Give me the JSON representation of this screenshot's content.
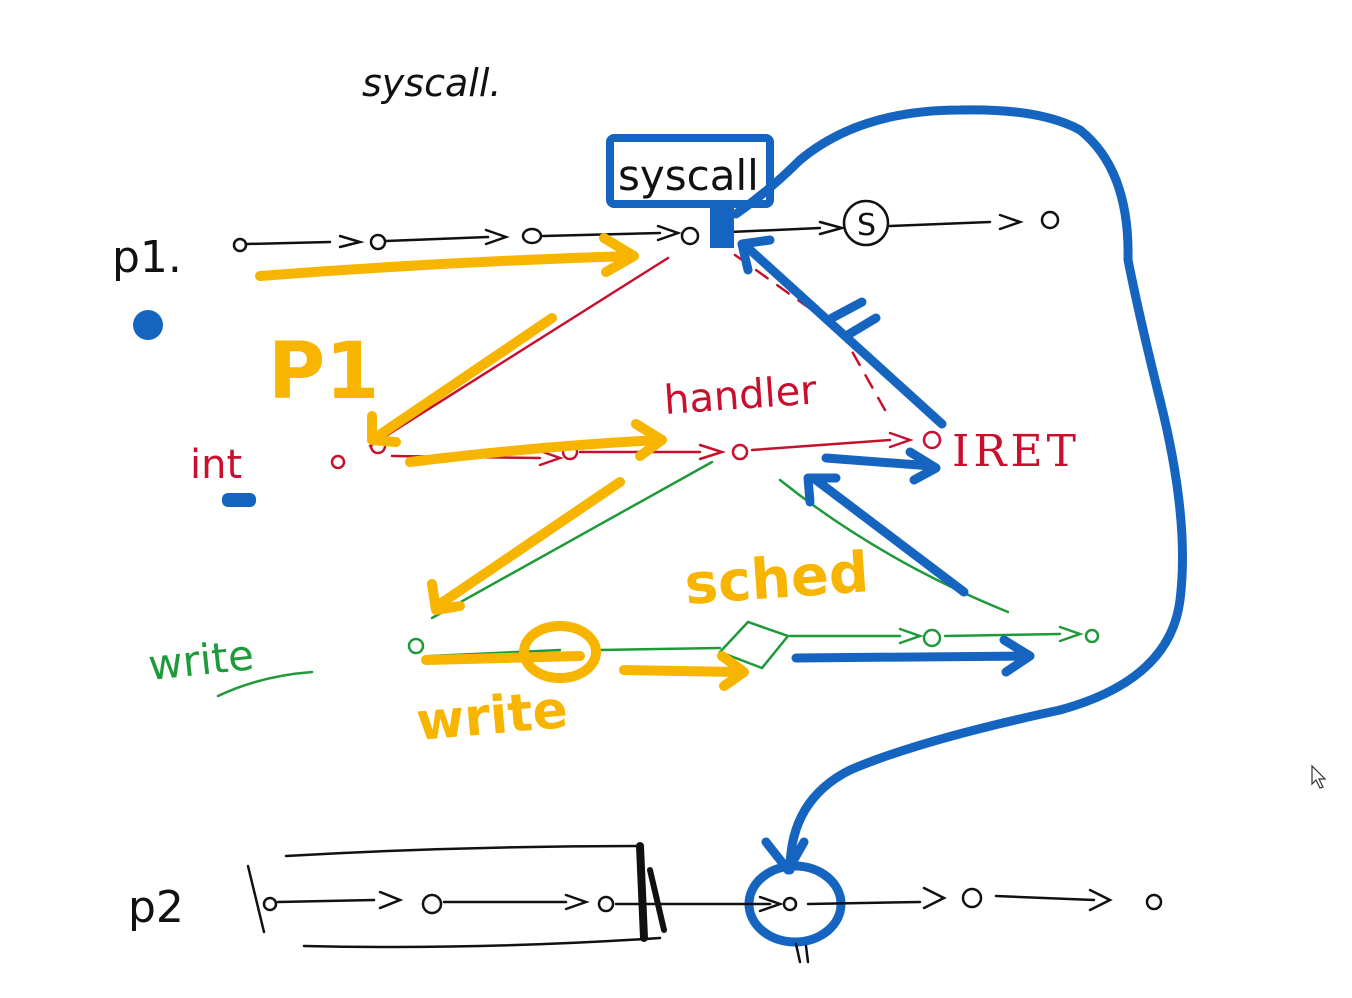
{
  "labels": {
    "top_note": "syscall.",
    "syscall_box": "syscall",
    "p1_label": "p1.",
    "p1_yellow": "P1",
    "int_label": "int",
    "handler_label": "handler",
    "iret_label": "IRET",
    "write_label": "write",
    "write_yellow": "write",
    "sched_yellow": "sched",
    "s_marker": "S",
    "p2_label": "p2"
  },
  "colors": {
    "ink_black": "#111111",
    "ink_red": "#c8102e",
    "ink_green": "#1f9a3a",
    "ink_yellow": "#f7b500",
    "ink_blue": "#1565c0"
  },
  "icons": {
    "cursor": "mouse-pointer-icon"
  }
}
